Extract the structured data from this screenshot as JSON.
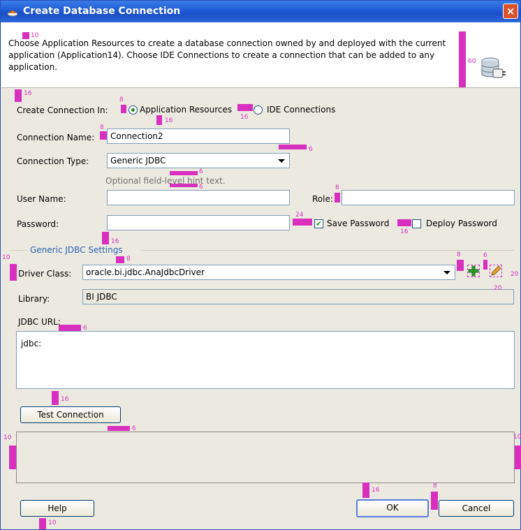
{
  "window": {
    "title": "Create Database Connection",
    "close_label": "×"
  },
  "header": {
    "description": "Choose Application Resources to create a database connection owned by and deployed with the current application (Application14). Choose IDE Connections to create a connection that can be added to any application."
  },
  "form": {
    "create_in_label": "Create Connection In:",
    "option_app_resources": "Application Resources",
    "option_ide": "IDE Connections",
    "connection_name_label": "Connection Name:",
    "connection_name_value": "Connection2",
    "connection_type_label": "Connection Type:",
    "connection_type_value": "Generic JDBC",
    "hint_text": "Optional field-level hint text.",
    "user_name_label": "User Name:",
    "role_label": "Role:",
    "password_label": "Password:",
    "save_password_label": "Save Password",
    "deploy_password_label": "Deploy Password"
  },
  "jdbc": {
    "group_label": "Generic JDBC Settings",
    "driver_class_label": "Driver Class:",
    "driver_class_value": "oracle.bi.jdbc.AnaJdbcDriver",
    "library_label": "Library:",
    "library_value": "BI JDBC",
    "url_label": "JDBC URL:",
    "url_value": "jdbc:"
  },
  "buttons": {
    "test_connection": "Test Connection",
    "help": "Help",
    "ok": "OK",
    "cancel": "Cancel"
  },
  "spacing_annotations": {
    "m10a": "10",
    "m60": "60",
    "m16a": "16",
    "m8a": "8",
    "m16b": "16",
    "m16c": "16",
    "m8b": "8",
    "m6a": "6",
    "m6b": "6",
    "m6c": "6",
    "m8c": "8",
    "m24": "24",
    "m16d": "16",
    "m16e": "16",
    "m10b": "10",
    "m8d": "8",
    "m8e": "8",
    "m6d": "6",
    "m20a": "20",
    "m20b": "20",
    "m6e": "6",
    "m16f": "16",
    "m6f": "6",
    "m10c": "10",
    "m10d": "10",
    "m16g": "16",
    "m8f": "8",
    "m10e": "10"
  }
}
